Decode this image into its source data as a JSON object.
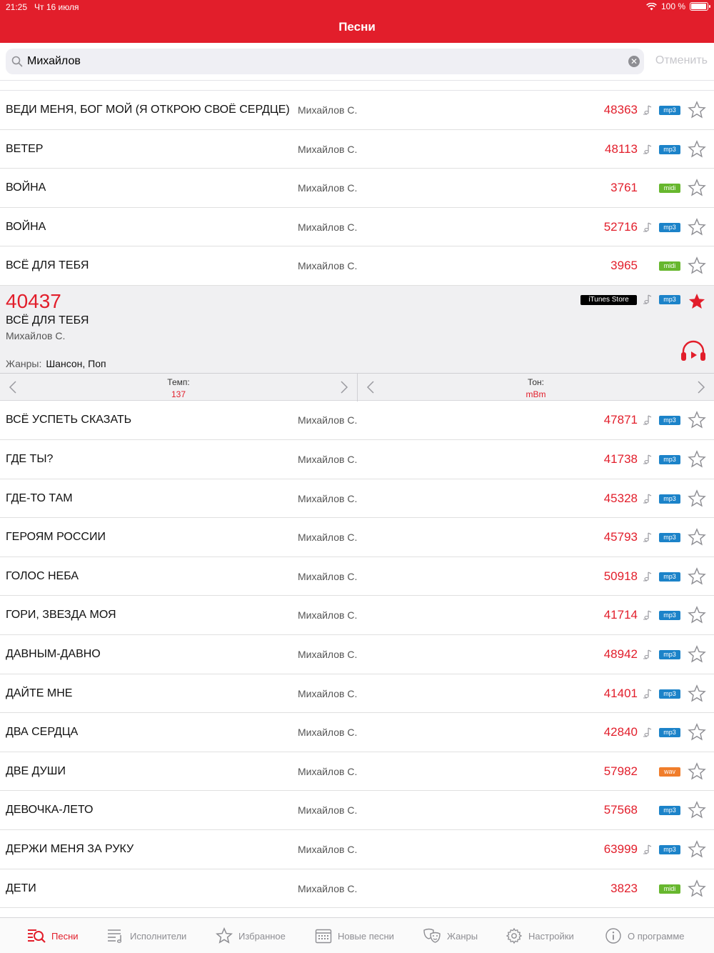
{
  "status": {
    "time": "21:25",
    "date": "Чт 16 июля",
    "battery": "100 %",
    "battery_level": 1.0
  },
  "nav": {
    "title": "Песни"
  },
  "search": {
    "value": "Михайлов",
    "cancel": "Отменить"
  },
  "songs_before": [
    {
      "title": "ВЕДИ МЕНЯ, БОГ МОЙ (Я ОТКРОЮ СВОЁ СЕРДЦЕ)",
      "artist": "Михайлов С.",
      "number": "48363",
      "format": "mp3",
      "note": true
    },
    {
      "title": "ВЕТЕР",
      "artist": "Михайлов С.",
      "number": "48113",
      "format": "mp3",
      "note": true
    },
    {
      "title": "ВОЙНА",
      "artist": "Михайлов С.",
      "number": "3761",
      "format": "midi",
      "note": false
    },
    {
      "title": "ВОЙНА",
      "artist": "Михайлов С.",
      "number": "52716",
      "format": "mp3",
      "note": true
    },
    {
      "title": "ВСЁ ДЛЯ ТЕБЯ",
      "artist": "Михайлов С.",
      "number": "3965",
      "format": "midi",
      "note": false
    }
  ],
  "expanded": {
    "number": "40437",
    "title": "ВСЁ ДЛЯ ТЕБЯ",
    "artist": "Михайлов С.",
    "genres_label": "Жанры:",
    "genres": "Шансон, Поп",
    "store": "iTunes Store",
    "format": "mp3",
    "tempo_label": "Темп:",
    "tempo": "137",
    "key_label": "Тон:",
    "key": "mBm"
  },
  "songs_after": [
    {
      "title": "ВСЁ УСПЕТЬ СКАЗАТЬ",
      "artist": "Михайлов С.",
      "number": "47871",
      "format": "mp3",
      "note": true
    },
    {
      "title": "ГДЕ ТЫ?",
      "artist": "Михайлов С.",
      "number": "41738",
      "format": "mp3",
      "note": true
    },
    {
      "title": "ГДЕ-ТО ТАМ",
      "artist": "Михайлов С.",
      "number": "45328",
      "format": "mp3",
      "note": true
    },
    {
      "title": "ГЕРОЯМ РОССИИ",
      "artist": "Михайлов С.",
      "number": "45793",
      "format": "mp3",
      "note": true
    },
    {
      "title": "ГОЛОС НЕБА",
      "artist": "Михайлов С.",
      "number": "50918",
      "format": "mp3",
      "note": true
    },
    {
      "title": "ГОРИ, ЗВЕЗДА МОЯ",
      "artist": "Михайлов С.",
      "number": "41714",
      "format": "mp3",
      "note": true
    },
    {
      "title": "ДАВНЫМ-ДАВНО",
      "artist": "Михайлов С.",
      "number": "48942",
      "format": "mp3",
      "note": true
    },
    {
      "title": "ДАЙТЕ МНЕ",
      "artist": "Михайлов С.",
      "number": "41401",
      "format": "mp3",
      "note": true
    },
    {
      "title": "ДВА СЕРДЦА",
      "artist": "Михайлов С.",
      "number": "42840",
      "format": "mp3",
      "note": true
    },
    {
      "title": "ДВЕ ДУШИ",
      "artist": "Михайлов С.",
      "number": "57982",
      "format": "wav",
      "note": false
    },
    {
      "title": "ДЕВОЧКА-ЛЕТО",
      "artist": "Михайлов С.",
      "number": "57568",
      "format": "mp3",
      "note": false
    },
    {
      "title": "ДЕРЖИ МЕНЯ ЗА РУКУ",
      "artist": "Михайлов С.",
      "number": "63999",
      "format": "mp3",
      "note": true
    },
    {
      "title": "ДЕТИ",
      "artist": "Михайлов С.",
      "number": "3823",
      "format": "midi",
      "note": false
    }
  ],
  "tabs": [
    {
      "label": "Песни",
      "icon": "songs-search-icon",
      "active": true
    },
    {
      "label": "Исполнители",
      "icon": "artists-list-icon",
      "active": false
    },
    {
      "label": "Избранное",
      "icon": "favorites-star-icon",
      "active": false
    },
    {
      "label": "Новые песни",
      "icon": "calendar-icon",
      "active": false
    },
    {
      "label": "Жанры",
      "icon": "theater-masks-icon",
      "active": false
    },
    {
      "label": "Настройки",
      "icon": "gear-icon",
      "active": false
    },
    {
      "label": "О программе",
      "icon": "info-icon",
      "active": false
    }
  ],
  "colors": {
    "accent": "#e21e2b",
    "mp3": "#1c83c9",
    "midi": "#67b72e",
    "wav": "#f07d2b",
    "star_outline": "#8e8e93"
  }
}
